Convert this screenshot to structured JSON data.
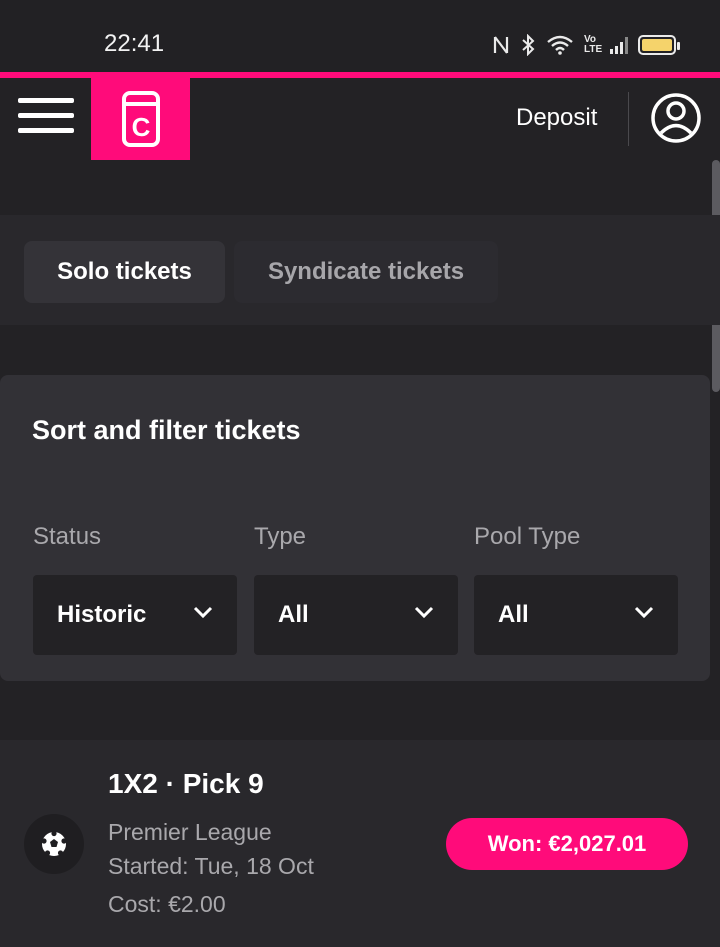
{
  "status_bar": {
    "time": "22:41",
    "icons": [
      "nfc-icon",
      "bluetooth-icon",
      "wifi-icon",
      "volte-icon",
      "signal-icon",
      "battery-icon"
    ],
    "volte_text": "Vo LTE"
  },
  "header": {
    "logo_letter": "C",
    "deposit_label": "Deposit",
    "accent_color": "#ff0b7a"
  },
  "tabs": [
    {
      "label": "Solo tickets",
      "active": true
    },
    {
      "label": "Syndicate tickets",
      "active": false
    }
  ],
  "filters": {
    "title": "Sort and filter tickets",
    "groups": [
      {
        "label": "Status",
        "value": "Historic"
      },
      {
        "label": "Type",
        "value": "All"
      },
      {
        "label": "Pool Type",
        "value": "All"
      }
    ]
  },
  "ticket": {
    "title": "1X2 · Pick 9",
    "league": "Premier League",
    "started": "Started: Tue, 18 Oct",
    "cost": "Cost: €2.00",
    "result": "Won: €2,027.01",
    "icon": "soccer-ball-icon"
  }
}
